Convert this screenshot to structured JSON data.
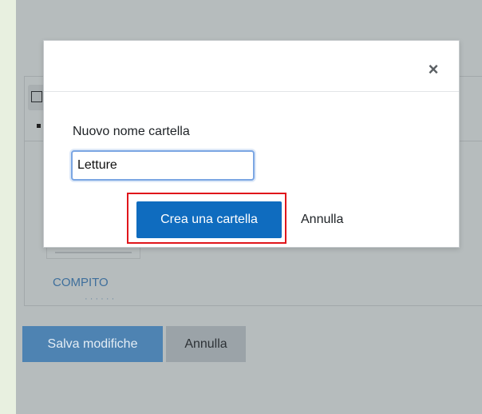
{
  "background": {
    "link_text": "COMPITO",
    "cut_text": "· · · · · ·",
    "save_button": "Salva modifiche",
    "cancel_button": "Annulla"
  },
  "dialog": {
    "close_icon": "×",
    "field_label": "Nuovo nome cartella",
    "field_value": "Letture",
    "create_button": "Crea una cartella",
    "cancel_button": "Annulla"
  },
  "colors": {
    "primary": "#0f6cbf",
    "highlight": "#e0161b",
    "focus": "#7ba6e3"
  }
}
